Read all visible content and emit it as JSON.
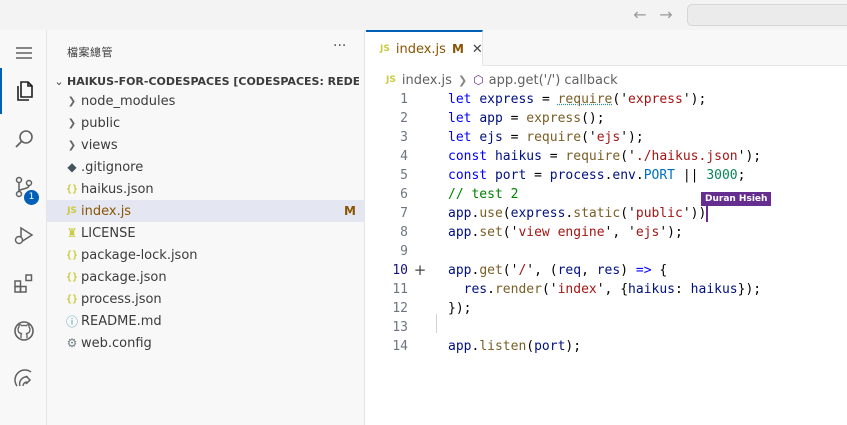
{
  "explorer": {
    "title": "檔案總管",
    "more_icon": "ellipsis-icon",
    "folder": "HAIKUS-FOR-CODESPACES [CODESPACES: REDESIGNED...",
    "items": [
      {
        "label": "node_modules",
        "type": "folder",
        "status": ""
      },
      {
        "label": "public",
        "type": "folder",
        "status": ""
      },
      {
        "label": "views",
        "type": "folder",
        "status": ""
      },
      {
        "label": ".gitignore",
        "type": "git",
        "status": ""
      },
      {
        "label": "haikus.json",
        "type": "json",
        "status": ""
      },
      {
        "label": "index.js",
        "type": "js",
        "status": "M"
      },
      {
        "label": "LICENSE",
        "type": "license",
        "status": ""
      },
      {
        "label": "package-lock.json",
        "type": "json",
        "status": ""
      },
      {
        "label": "package.json",
        "type": "json",
        "status": ""
      },
      {
        "label": "process.json",
        "type": "json",
        "status": ""
      },
      {
        "label": "README.md",
        "type": "info",
        "status": ""
      },
      {
        "label": "web.config",
        "type": "gear",
        "status": ""
      }
    ]
  },
  "activity": {
    "source_control_badge": "1"
  },
  "editor": {
    "tab": {
      "icon_text": "JS",
      "label": "index.js",
      "status": "M"
    },
    "breadcrumb": {
      "file": "index.js",
      "symbol": "app.get('/') callback"
    },
    "collaborator": "Duran Hsieh",
    "current_line": "10",
    "lines": [
      {
        "n": "1"
      },
      {
        "n": "2"
      },
      {
        "n": "3"
      },
      {
        "n": "4"
      },
      {
        "n": "5"
      },
      {
        "n": "6"
      },
      {
        "n": "7"
      },
      {
        "n": "8"
      },
      {
        "n": "9"
      },
      {
        "n": "10"
      },
      {
        "n": "11"
      },
      {
        "n": "12"
      },
      {
        "n": "13"
      },
      {
        "n": "14"
      }
    ],
    "code": {
      "l1": [
        "let",
        "express",
        "=",
        "require",
        "('",
        "express",
        "');"
      ],
      "l2": [
        "let",
        "app",
        "=",
        "express",
        "();"
      ],
      "l3": [
        "let",
        "ejs",
        "=",
        "require",
        "('",
        "ejs",
        "');"
      ],
      "l4": [
        "const",
        "haikus",
        "=",
        "require",
        "('",
        "./haikus.json",
        "');"
      ],
      "l5": [
        "const",
        "port",
        "=",
        "process",
        ".",
        "env",
        ".",
        "PORT",
        "||",
        "3000",
        ";"
      ],
      "l6": "// test 2",
      "l7": [
        "app",
        ".",
        "use",
        "(",
        "express",
        ".",
        "static",
        "('",
        "public",
        "'))"
      ],
      "l8": [
        "app",
        ".",
        "set",
        "('",
        "view engine",
        "', '",
        "ejs",
        "');"
      ],
      "l10": [
        "app",
        ".",
        "get",
        "('",
        "/",
        "', (",
        "req",
        ",",
        "res",
        ")",
        "=>",
        "{"
      ],
      "l11": [
        "res",
        ".",
        "render",
        "('",
        "index",
        "', {",
        "haikus",
        ":",
        "haikus",
        "});"
      ],
      "l12": "});",
      "l14": [
        "app",
        ".",
        "listen",
        "(",
        "port",
        ");"
      ]
    }
  }
}
